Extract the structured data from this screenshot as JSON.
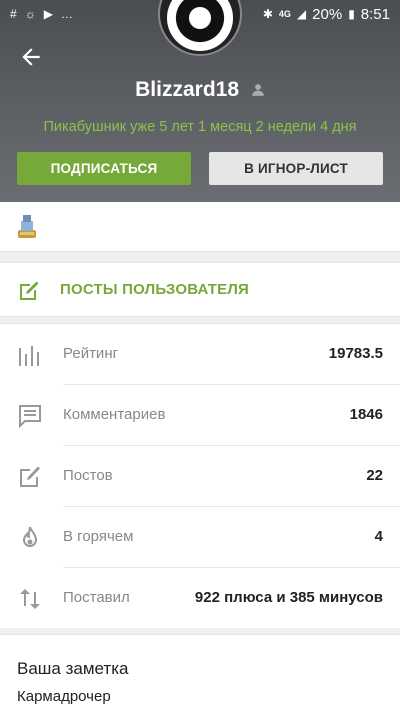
{
  "status_bar": {
    "battery": "20%",
    "time": "8:51",
    "network": "4G"
  },
  "profile": {
    "username": "Blizzard18",
    "since": "Пикабушник уже 5 лет 1 месяц 2 недели 4 дня"
  },
  "actions": {
    "subscribe_label": "ПОДПИСАТЬСЯ",
    "ignore_label": "В ИГНОР-ЛИСТ"
  },
  "posts_link": {
    "label": "ПОСТЫ ПОЛЬЗОВАТЕЛЯ"
  },
  "stats": [
    {
      "label": "Рейтинг",
      "value": "19783.5",
      "icon": "bar-chart-icon"
    },
    {
      "label": "Комментариев",
      "value": "1846",
      "icon": "comment-icon"
    },
    {
      "label": "Постов",
      "value": "22",
      "icon": "edit-icon"
    },
    {
      "label": "В горячем",
      "value": "4",
      "icon": "fire-icon"
    },
    {
      "label": "Поставил",
      "value": "922 плюса и 385 минусов",
      "icon": "swap-vertical-icon"
    }
  ],
  "note": {
    "title": "Ваша заметка",
    "text": "Кармадрочер"
  },
  "colors": {
    "accent": "#76a83a",
    "since_text": "#8bc34a"
  }
}
